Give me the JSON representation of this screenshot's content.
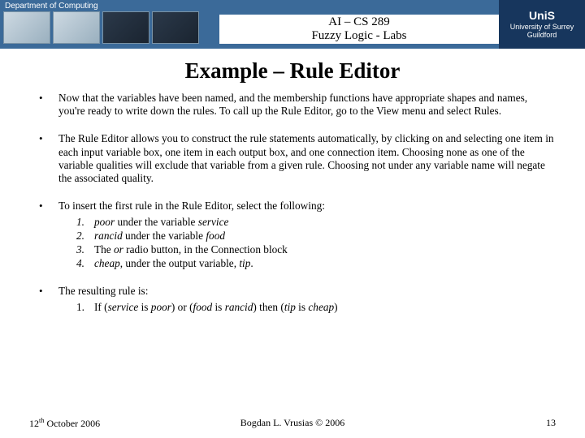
{
  "header": {
    "dept": "Department of Computing",
    "course_line1": "AI – CS 289",
    "course_line2": "Fuzzy Logic - Labs",
    "uni_brand": "UniS",
    "uni_sub1": "University of Surrey",
    "uni_sub2": "Guildford"
  },
  "title": "Example – Rule Editor",
  "bullets": {
    "b1": "Now that the variables have been named, and the membership functions have appropriate shapes and names, you're ready to write down the rules. To call up the Rule Editor, go to the View menu and select Rules.",
    "b2": "The Rule Editor allows you to construct the rule statements automatically, by clicking on and selecting one item in each input variable box, one item in each output box, and one connection item. Choosing none as one of the variable qualities will exclude that variable from a given rule. Choosing not under any variable name will negate the associated quality.",
    "b3": "To insert the first rule in the Rule Editor, select the following:",
    "b3_items": {
      "i1_a": "poor",
      "i1_b": " under the variable ",
      "i1_c": "service",
      "i2_a": "rancid",
      "i2_b": " under the variable ",
      "i2_c": "food",
      "i3_a": "The ",
      "i3_b": "or",
      "i3_c": " radio button, in the Connection block",
      "i4_a": "cheap",
      "i4_b": ", under the output variable, ",
      "i4_c": "tip",
      "i4_d": "."
    },
    "b4": "The resulting rule is:",
    "b4_rule_a": "If (",
    "b4_rule_b": "service",
    "b4_rule_c": " is ",
    "b4_rule_d": "poor",
    "b4_rule_e": ") or (",
    "b4_rule_f": "food",
    "b4_rule_g": " is ",
    "b4_rule_h": "rancid",
    "b4_rule_i": ") then (",
    "b4_rule_j": "tip",
    "b4_rule_k": " is ",
    "b4_rule_l": "cheap",
    "b4_rule_m": ")"
  },
  "footer": {
    "date_pre": "12",
    "date_sup": "th",
    "date_post": " October 2006",
    "author": "Bogdan L. Vrusias © 2006",
    "page": "13"
  }
}
